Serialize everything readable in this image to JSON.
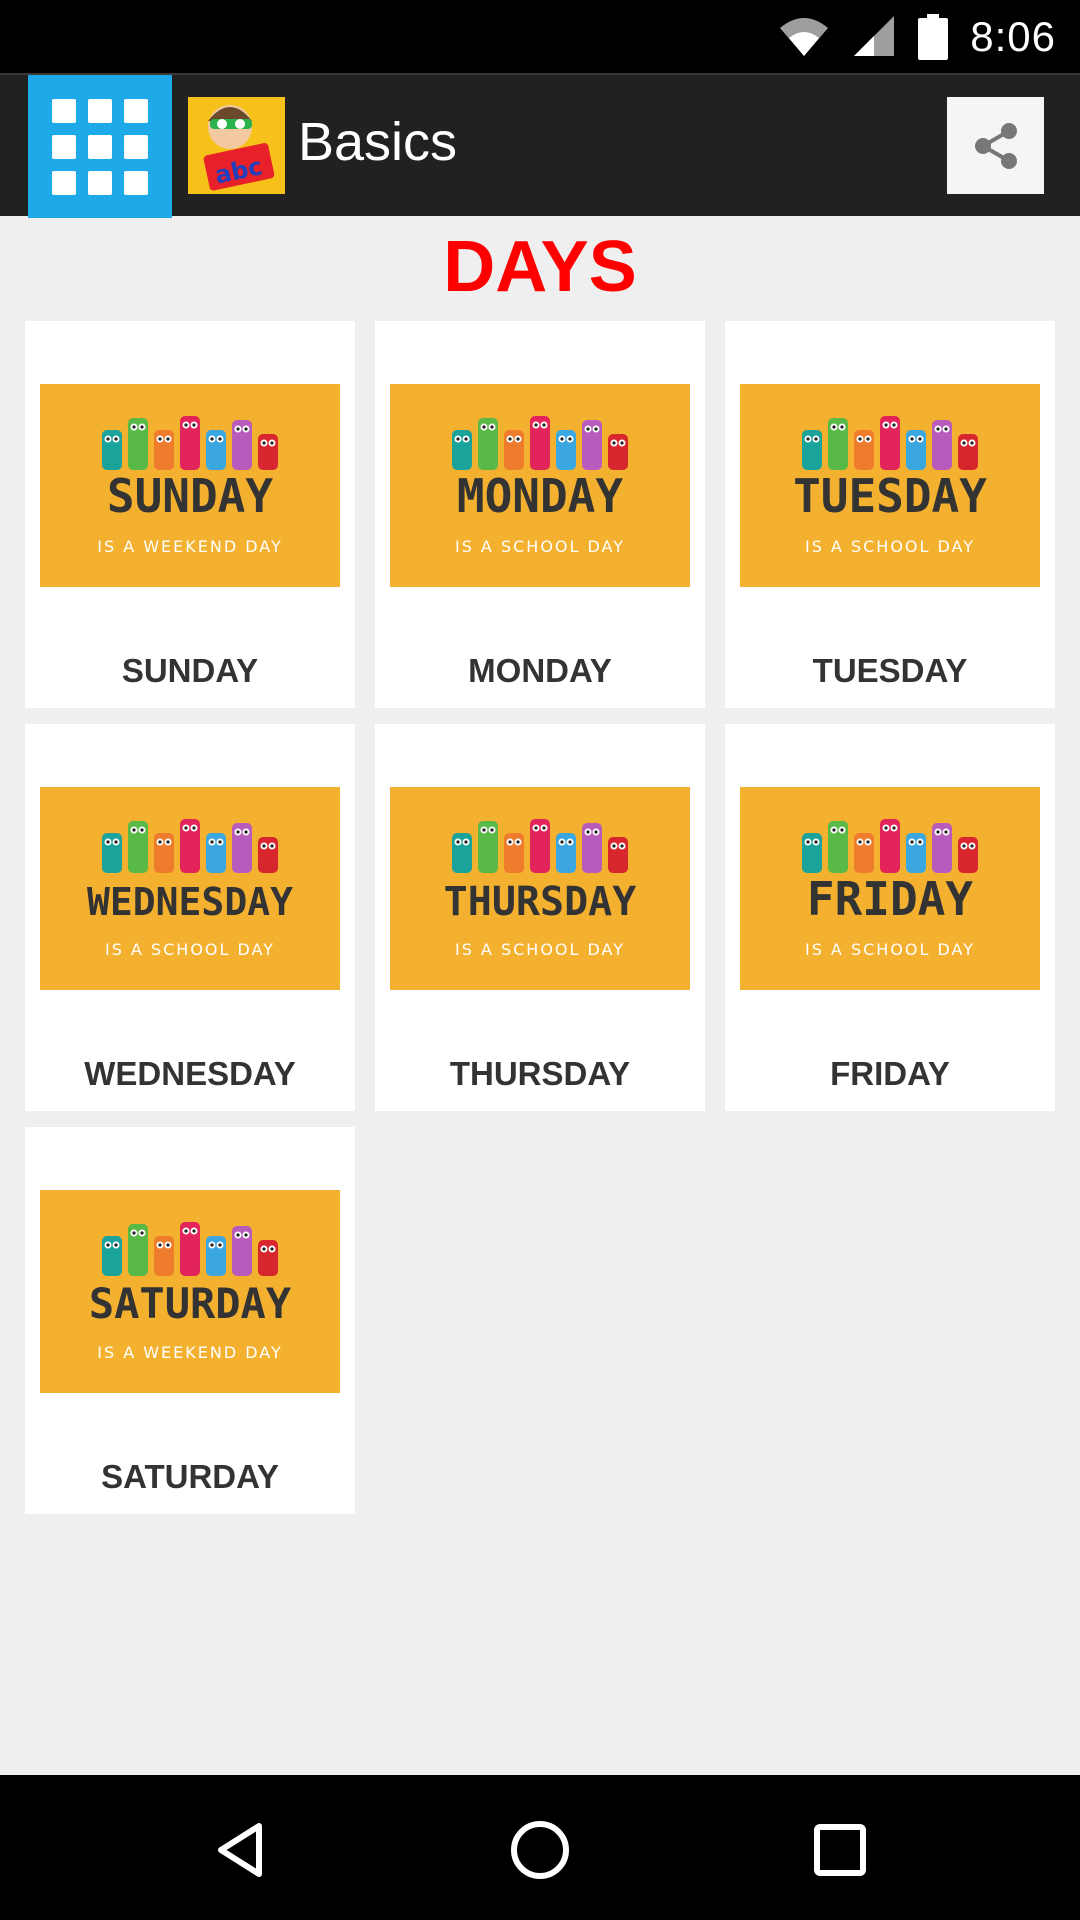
{
  "status_bar": {
    "time": "8:06",
    "icons": [
      "wifi-icon",
      "cell-signal-icon",
      "battery-icon"
    ]
  },
  "toolbar": {
    "menu_icon": "grid-menu-icon",
    "logo_icon": "app-logo-icon",
    "title": "Basics",
    "share_icon": "share-icon"
  },
  "page": {
    "heading": "DAYS"
  },
  "days": [
    {
      "label": "SUNDAY",
      "image_title": "SUNDAY",
      "image_subtitle": "IS A WEEKEND DAY"
    },
    {
      "label": "MONDAY",
      "image_title": "MONDAY",
      "image_subtitle": "IS A SCHOOL DAY"
    },
    {
      "label": "TUESDAY",
      "image_title": "TUESDAY",
      "image_subtitle": "IS A SCHOOL DAY"
    },
    {
      "label": "WEDNESDAY",
      "image_title": "WEDNESDAY",
      "image_subtitle": "IS A SCHOOL DAY"
    },
    {
      "label": "THURSDAY",
      "image_title": "THURSDAY",
      "image_subtitle": "IS A SCHOOL DAY"
    },
    {
      "label": "FRIDAY",
      "image_title": "FRIDAY",
      "image_subtitle": "IS A SCHOOL DAY"
    },
    {
      "label": "SATURDAY",
      "image_title": "SATURDAY",
      "image_subtitle": "IS A WEEKEND DAY"
    }
  ],
  "colors": {
    "accent": "#1ea9e8",
    "heading": "#ff0000",
    "card_image_bg": "#f4b130",
    "monsters": [
      "#1aa39a",
      "#58b947",
      "#ef7b2c",
      "#e2245a",
      "#3aa7e0",
      "#b75bbd",
      "#d8262e"
    ]
  },
  "nav_bar": {
    "icons": [
      "back-icon",
      "home-icon",
      "recents-icon"
    ]
  }
}
